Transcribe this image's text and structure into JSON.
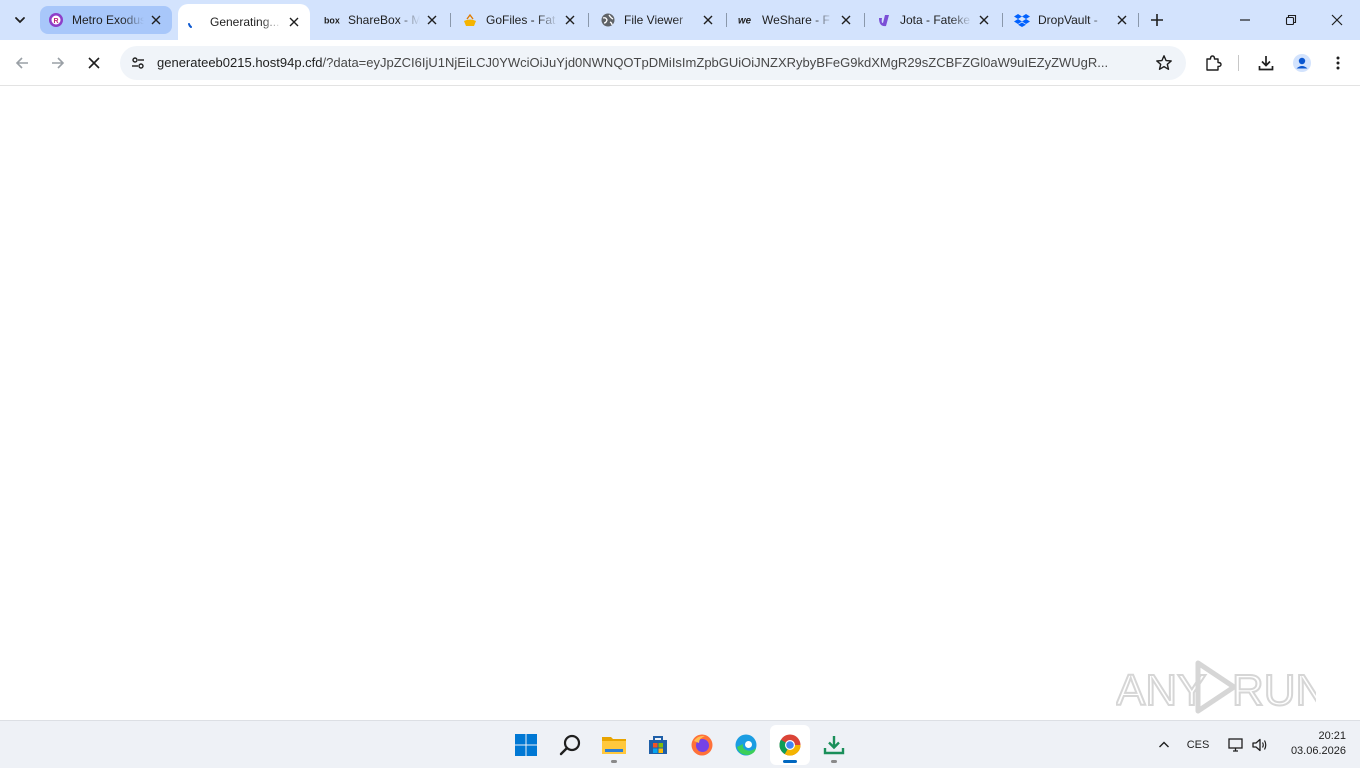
{
  "browser": {
    "tabs": [
      {
        "title": "Metro Exodus",
        "favicon": "metro-exodus-icon",
        "state": "inactive-highlighted"
      },
      {
        "title": "Generating...",
        "favicon": "loading-spinner-icon",
        "state": "active"
      },
      {
        "title": "ShareBox - M",
        "favicon": "box-logo-icon",
        "state": "inactive"
      },
      {
        "title": "GoFiles - Fat",
        "favicon": "gofiles-icon",
        "state": "inactive"
      },
      {
        "title": "File Viewer",
        "favicon": "globe-icon",
        "state": "inactive"
      },
      {
        "title": "WeShare - F",
        "favicon": "wetransfer-logo-icon",
        "state": "inactive"
      },
      {
        "title": "Jota - Fateke",
        "favicon": "jota-icon",
        "state": "inactive"
      },
      {
        "title": "DropVault - ",
        "favicon": "dropbox-icon",
        "state": "inactive"
      }
    ],
    "address_bar": {
      "host": "generateeb0215.host94p.cfd",
      "rest": "/?data=eyJpZCI6IjU1NjEiLCJ0YWciOiJuYjd0NWNQOTpDMiIsImZpbGUiOiJNZXRybyBFeG9kdXMgR29sZCBFZGl0aW9uIEZyZWUgR..."
    }
  },
  "watermark": {
    "text": "ANY RUN"
  },
  "taskbar": {
    "apps": [
      {
        "name": "start-button",
        "icon": "windows-logo-icon"
      },
      {
        "name": "search-button",
        "icon": "search-icon"
      },
      {
        "name": "file-explorer",
        "icon": "folder-icon"
      },
      {
        "name": "microsoft-store",
        "icon": "store-icon"
      },
      {
        "name": "firefox",
        "icon": "firefox-icon"
      },
      {
        "name": "edge",
        "icon": "edge-icon"
      },
      {
        "name": "chrome",
        "icon": "chrome-icon"
      },
      {
        "name": "downloads",
        "icon": "download-icon"
      }
    ],
    "tray": {
      "language": "CES",
      "time": "20:21",
      "date": "03.06.2026"
    }
  },
  "colors": {
    "tabstrip": "#d3e3fd",
    "omnibox": "#f0f4f9",
    "taskbar": "#eef1f6",
    "accent": "#0067c0"
  }
}
